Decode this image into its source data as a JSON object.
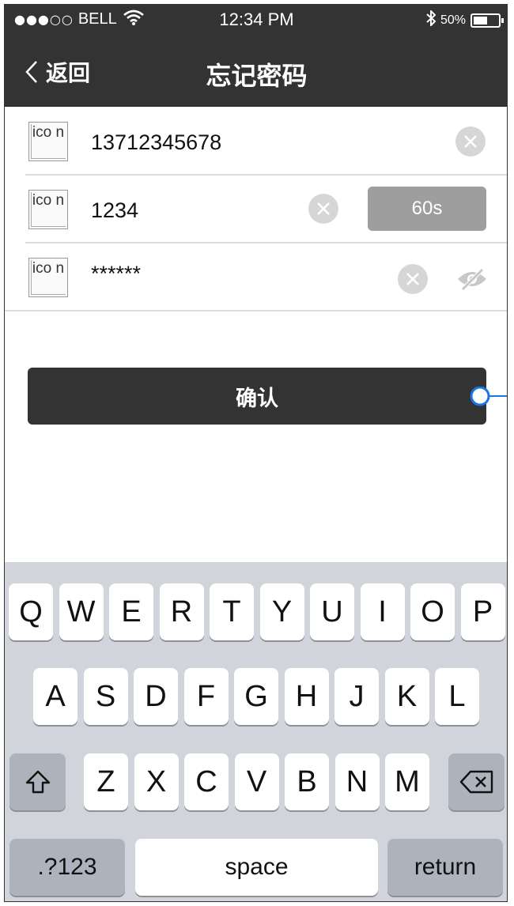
{
  "status_bar": {
    "signal_dots": "●●●○○",
    "carrier": "BELL",
    "wifi_icon": "wifi-icon",
    "time": "12:34 PM",
    "bluetooth_icon": "bluetooth-icon",
    "battery_percent": "50%",
    "battery_level": 0.5
  },
  "nav": {
    "back_label": "返回",
    "title": "忘记密码"
  },
  "form": {
    "placeholder_icon_text": "ico n",
    "phone_value": "13712345678",
    "code_value": "1234",
    "code_button_label": "60s",
    "password_value": "******"
  },
  "confirm_label": "确认",
  "keyboard": {
    "row1": [
      "Q",
      "W",
      "E",
      "R",
      "T",
      "Y",
      "U",
      "I",
      "O",
      "P"
    ],
    "row2": [
      "A",
      "S",
      "D",
      "F",
      "G",
      "H",
      "J",
      "K",
      "L"
    ],
    "row3": [
      "Z",
      "X",
      "C",
      "V",
      "B",
      "N",
      "M"
    ],
    "numbers_label": ".?123",
    "space_label": "space",
    "return_label": "return"
  },
  "colors": {
    "header_bg": "#333333",
    "clear_icon_bg": "#d6d6d6",
    "code_button_bg": "#9e9e9e",
    "keyboard_bg": "#d1d5db",
    "connector_accent": "#1a73e8"
  }
}
